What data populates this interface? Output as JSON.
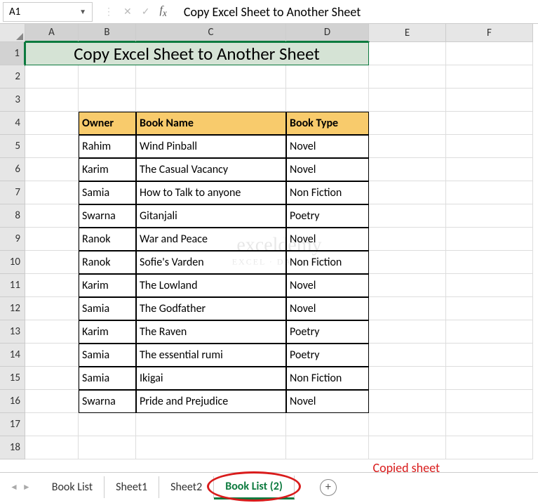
{
  "nameBox": "A1",
  "formulaValue": "Copy Excel Sheet to Another Sheet",
  "columns": [
    "A",
    "B",
    "C",
    "D",
    "E",
    "F"
  ],
  "rows": [
    "1",
    "2",
    "3",
    "4",
    "5",
    "6",
    "7",
    "8",
    "9",
    "10",
    "11",
    "12",
    "13",
    "14",
    "15",
    "16",
    "17",
    "18"
  ],
  "title": "Copy Excel Sheet to Another Sheet",
  "headers": {
    "owner": "Owner",
    "book": "Book Name",
    "type": "Book Type"
  },
  "data": [
    {
      "owner": "Rahim",
      "book": "Wind Pinball",
      "type": "Novel"
    },
    {
      "owner": "Karim",
      "book": "The Casual Vacancy",
      "type": "Novel"
    },
    {
      "owner": "Samia",
      "book": "How to Talk to anyone",
      "type": "Non Fiction"
    },
    {
      "owner": "Swarna",
      "book": "Gitanjali",
      "type": "Poetry"
    },
    {
      "owner": "Ranok",
      "book": "War and Peace",
      "type": "Novel"
    },
    {
      "owner": "Ranok",
      "book": "Sofie's Varden",
      "type": "Non Fiction"
    },
    {
      "owner": "Karim",
      "book": "The Lowland",
      "type": "Novel"
    },
    {
      "owner": "Samia",
      "book": "The Godfather",
      "type": "Novel"
    },
    {
      "owner": "Karim",
      "book": "The Raven",
      "type": "Poetry"
    },
    {
      "owner": "Samia",
      "book": "The essential rumi",
      "type": "Poetry"
    },
    {
      "owner": "Samia",
      "book": "Ikigai",
      "type": "Non Fiction"
    },
    {
      "owner": "Swarna",
      "book": "Pride and Prejudice",
      "type": "Novel"
    }
  ],
  "tabs": [
    "Book List",
    "Sheet1",
    "Sheet2",
    "Book List (2)"
  ],
  "activeTab": 3,
  "copiedLabel": "Copied sheet"
}
